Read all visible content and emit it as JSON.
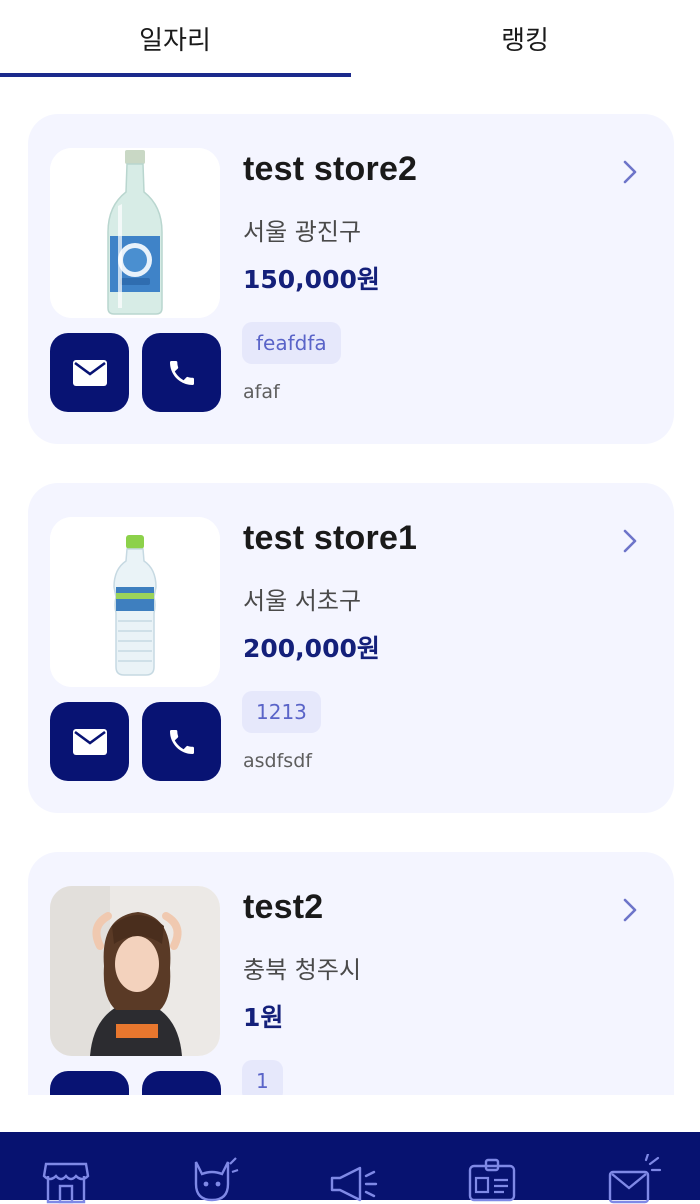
{
  "tabs": [
    {
      "label": "일자리",
      "active": true
    },
    {
      "label": "랭킹",
      "active": false
    }
  ],
  "jobs": [
    {
      "name": "test store2",
      "location": "서울 광진구",
      "pay": "150,000원",
      "tag": "feafdfa",
      "description": "afaf",
      "thumbnail": "soju-bottle-image"
    },
    {
      "name": "test store1",
      "location": "서울 서초구",
      "pay": "200,000원",
      "tag": "1213",
      "description": "asdfsdf",
      "thumbnail": "water-bottle-image"
    },
    {
      "name": "test2",
      "location": "충북 청주시",
      "pay": "1원",
      "tag": "1",
      "description": "",
      "thumbnail": "person-photo"
    }
  ],
  "bottom_nav": {
    "items": [
      "store-icon",
      "cat-icon",
      "megaphone-icon",
      "id-card-icon",
      "mail-sparkle-icon"
    ]
  },
  "colors": {
    "primary": "#071270",
    "card_bg": "#f4f5ff",
    "chip_bg": "#e6e8fb",
    "chip_text": "#5a64c8",
    "price": "#14207a",
    "chevron": "#6d74c9"
  }
}
